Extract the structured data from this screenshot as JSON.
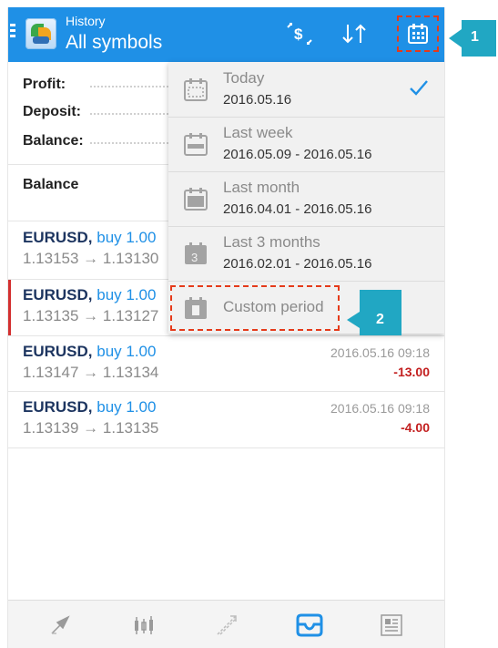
{
  "header": {
    "title": "History",
    "subtitle": "All symbols",
    "icons": [
      "menu-icon",
      "app-logo",
      "currency-icon",
      "sort-icon",
      "calendar-icon"
    ]
  },
  "summary": {
    "profit_label": "Profit:",
    "deposit_label": "Deposit:",
    "balance_label": "Balance:",
    "balance_section_label": "Balance"
  },
  "deals": [
    {
      "symbol": "EURUSD,",
      "action": "buy 1.00",
      "prices": "1.13153 → 1.13130",
      "time": "",
      "pl": ""
    },
    {
      "symbol": "EURUSD,",
      "action": "buy 1.00",
      "prices": "1.13135 → 1.13127",
      "time": "",
      "pl": ""
    },
    {
      "symbol": "EURUSD,",
      "action": "buy 1.00",
      "prices": "1.13147 → 1.13134",
      "time": "2016.05.16 09:18",
      "pl": "-13.00"
    },
    {
      "symbol": "EURUSD,",
      "action": "buy 1.00",
      "prices": "1.13139 → 1.13135",
      "time": "2016.05.16 09:18",
      "pl": "-4.00"
    }
  ],
  "period_menu": {
    "items": [
      {
        "label": "Today",
        "range": "2016.05.16",
        "selected": true
      },
      {
        "label": "Last week",
        "range": "2016.05.09 - 2016.05.16",
        "selected": false
      },
      {
        "label": "Last month",
        "range": "2016.04.01 - 2016.05.16",
        "selected": false
      },
      {
        "label": "Last 3 months",
        "range": "2016.02.01 - 2016.05.16",
        "selected": false,
        "icon_text": "3"
      },
      {
        "label": "Custom period",
        "range": "",
        "selected": false
      }
    ]
  },
  "callouts": {
    "one": "1",
    "two": "2"
  },
  "bottom_nav": [
    "quotes-icon",
    "chart-icon",
    "trade-icon",
    "history-icon",
    "news-icon"
  ],
  "colors": {
    "accent": "#1f90e6",
    "callout": "#21a7c3",
    "highlight_dash": "#e53a1a",
    "loss": "#c32020"
  }
}
